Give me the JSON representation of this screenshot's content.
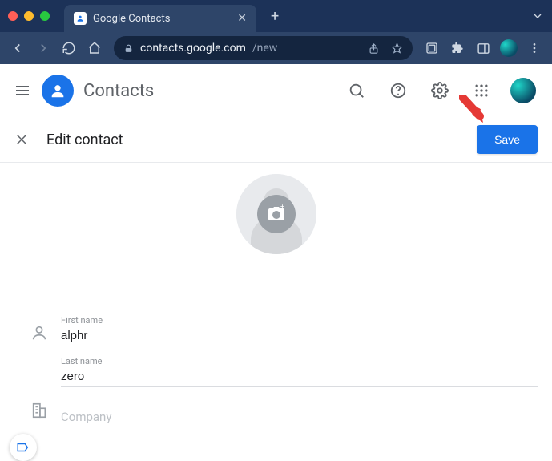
{
  "browser": {
    "tab_title": "Google Contacts",
    "url_domain": "contacts.google.com",
    "url_path": "/new"
  },
  "app": {
    "title": "Contacts"
  },
  "edit_bar": {
    "title": "Edit contact",
    "save_label": "Save"
  },
  "fields": {
    "first_name_label": "First name",
    "first_name_value": "alphr",
    "last_name_label": "Last name",
    "last_name_value": "zero",
    "company_label": "Company"
  }
}
